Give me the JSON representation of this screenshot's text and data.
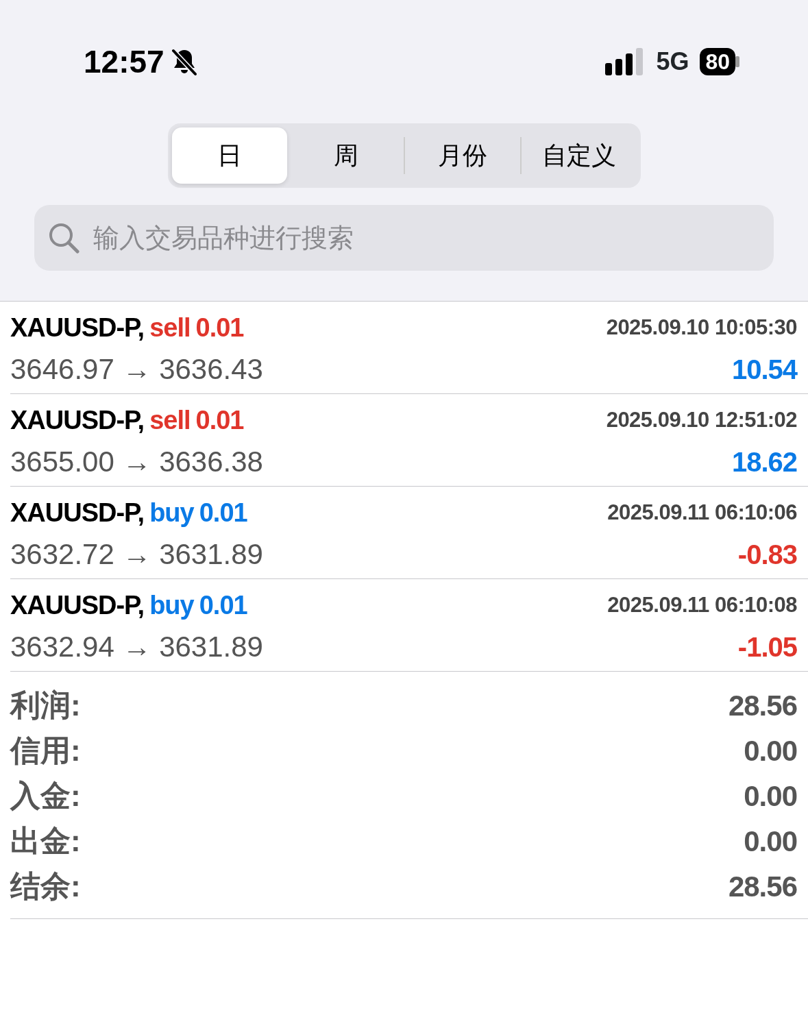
{
  "status_bar": {
    "time": "12:57",
    "network": "5G",
    "battery": "80",
    "silent": true
  },
  "period_tabs": [
    {
      "label": "日",
      "selected": true
    },
    {
      "label": "周",
      "selected": false
    },
    {
      "label": "月份",
      "selected": false
    },
    {
      "label": "自定义",
      "selected": false
    }
  ],
  "search": {
    "placeholder": "输入交易品种进行搜索"
  },
  "trades": [
    {
      "symbol": "XAUUSD-P,",
      "side": "sell",
      "volume": "0.01",
      "time": "2025.09.10 10:05:30",
      "prices": "3646.97 → 3636.43",
      "profit": "10.54",
      "loss": false
    },
    {
      "symbol": "XAUUSD-P,",
      "side": "sell",
      "volume": "0.01",
      "time": "2025.09.10 12:51:02",
      "prices": "3655.00 → 3636.38",
      "profit": "18.62",
      "loss": false
    },
    {
      "symbol": "XAUUSD-P,",
      "side": "buy",
      "volume": "0.01",
      "time": "2025.09.11 06:10:06",
      "prices": "3632.72 → 3631.89",
      "profit": "-0.83",
      "loss": true
    },
    {
      "symbol": "XAUUSD-P,",
      "side": "buy",
      "volume": "0.01",
      "time": "2025.09.11 06:10:08",
      "prices": "3632.94 → 3631.89",
      "profit": "-1.05",
      "loss": true
    }
  ],
  "summary": [
    {
      "label": "利润:",
      "value": "28.56"
    },
    {
      "label": "信用:",
      "value": "0.00"
    },
    {
      "label": "入金:",
      "value": "0.00"
    },
    {
      "label": "出金:",
      "value": "0.00"
    },
    {
      "label": "结余:",
      "value": "28.56"
    }
  ]
}
